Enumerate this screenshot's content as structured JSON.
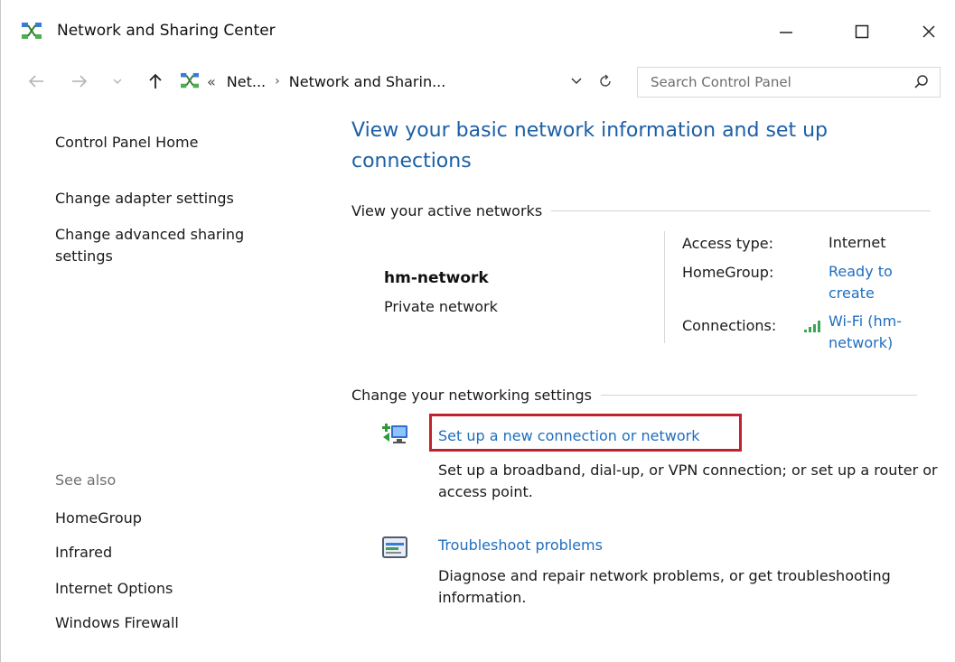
{
  "window": {
    "title": "Network and Sharing Center",
    "minimize_label": "—",
    "maximize_label": "☐",
    "close_label": "✕"
  },
  "address_bar": {
    "back_icon": "back-arrow-icon",
    "forward_icon": "forward-arrow-icon",
    "up_icon": "up-arrow-icon",
    "overflow": "«",
    "crumbs": [
      "Net...",
      "Network and Sharin..."
    ],
    "separator": "›",
    "search_placeholder": "Search Control Panel"
  },
  "sidebar": {
    "home": "Control Panel Home",
    "items": [
      "Change adapter settings",
      "Change advanced sharing settings"
    ],
    "see_also_label": "See also",
    "see_also": [
      "HomeGroup",
      "Infrared",
      "Internet Options",
      "Windows Firewall"
    ]
  },
  "main": {
    "title": "View your basic network information and set up connections",
    "active_networks_heading": "View your active networks",
    "network": {
      "name": "hm-network",
      "type": "Private network",
      "access_type_label": "Access type:",
      "access_type_value": "Internet",
      "homegroup_label": "HomeGroup:",
      "homegroup_value": "Ready to create",
      "connections_label": "Connections:",
      "connections_value": "Wi-Fi (hm-network)"
    },
    "change_settings_heading": "Change your networking settings",
    "tasks": [
      {
        "link": "Set up a new connection or network",
        "description": "Set up a broadband, dial-up, or VPN connection; or set up a router or access point.",
        "icon": "new-connection-icon"
      },
      {
        "link": "Troubleshoot problems",
        "description": "Diagnose and repair network problems, or get troubleshooting information.",
        "icon": "troubleshoot-icon"
      }
    ]
  },
  "colors": {
    "link": "#1f6ec0",
    "title": "#1c5fa6",
    "highlight": "#c0232d"
  }
}
